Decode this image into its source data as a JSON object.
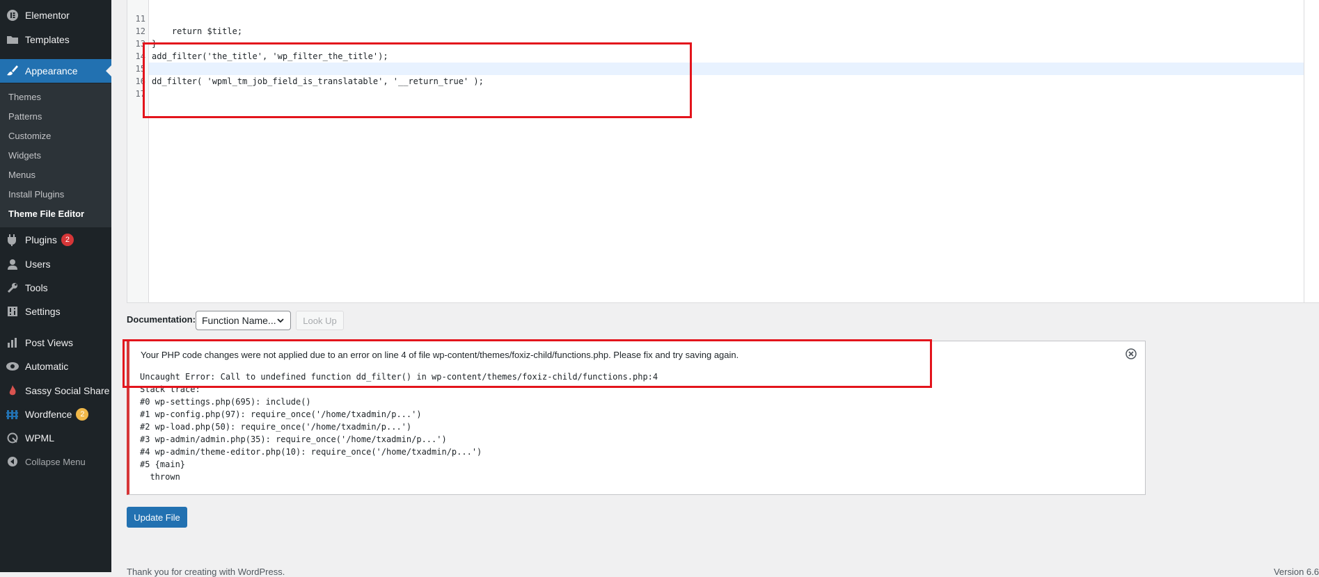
{
  "sidebar": {
    "top_items": [
      {
        "label": "Elementor",
        "icon": "elementor-icon"
      },
      {
        "label": "Templates",
        "icon": "folder-icon"
      }
    ],
    "appearance": {
      "label": "Appearance",
      "icon": "paintbrush-icon"
    },
    "submenu": [
      "Themes",
      "Patterns",
      "Customize",
      "Widgets",
      "Menus",
      "Install Plugins",
      "Theme File Editor"
    ],
    "items": [
      {
        "label": "Plugins",
        "icon": "plugin-icon",
        "badge": "2"
      },
      {
        "label": "Users",
        "icon": "user-icon"
      },
      {
        "label": "Tools",
        "icon": "wrench-icon"
      },
      {
        "label": "Settings",
        "icon": "settings-icon"
      },
      {
        "label": "Post Views",
        "icon": "chart-icon"
      },
      {
        "label": "Automatic",
        "icon": "automatic-icon"
      },
      {
        "label": "Sassy Social Share",
        "icon": "flame-icon"
      },
      {
        "label": "Wordfence",
        "icon": "wordfence-icon",
        "badge": "2"
      },
      {
        "label": "WPML",
        "icon": "wpml-icon"
      },
      {
        "label": "Collapse Menu",
        "icon": "collapse-icon"
      }
    ]
  },
  "editor": {
    "lines": [
      {
        "n": "11",
        "code": "    return $title;"
      },
      {
        "n": "12",
        "code": "}"
      },
      {
        "n": "13",
        "code": "add_filter('the_title', 'wp_filter_the_title');"
      },
      {
        "n": "14",
        "code": ""
      },
      {
        "n": "15",
        "code": "dd_filter( 'wpml_tm_job_field_is_translatable', '__return_true' );"
      },
      {
        "n": "16",
        "code": ""
      },
      {
        "n": "17",
        "code": ""
      }
    ]
  },
  "documentation": {
    "label": "Documentation:",
    "select_value": "Function Name...",
    "lookup_label": "Look Up"
  },
  "notice": {
    "message": "Your PHP code changes were not applied due to an error on line 4 of file wp-content/themes/foxiz-child/functions.php. Please fix and try saving again.",
    "trace": [
      "Uncaught Error: Call to undefined function dd_filter() in wp-content/themes/foxiz-child/functions.php:4",
      "Stack trace:",
      "#0 wp-settings.php(695): include()",
      "#1 wp-config.php(97): require_once('/home/txadmin/p...')",
      "#2 wp-load.php(50): require_once('/home/txadmin/p...')",
      "#3 wp-admin/admin.php(35): require_once('/home/txadmin/p...')",
      "#4 wp-admin/theme-editor.php(10): require_once('/home/txadmin/p...')",
      "#5 {main}",
      "  thrown"
    ]
  },
  "update_label": "Update File",
  "footer": {
    "left": "Thank you for creating with WordPress.",
    "right": "Version 6.6"
  },
  "colors": {
    "sidebar": "#1d2327",
    "accent": "#2271b1",
    "error": "#d63638",
    "annotation": "#e3141c"
  }
}
